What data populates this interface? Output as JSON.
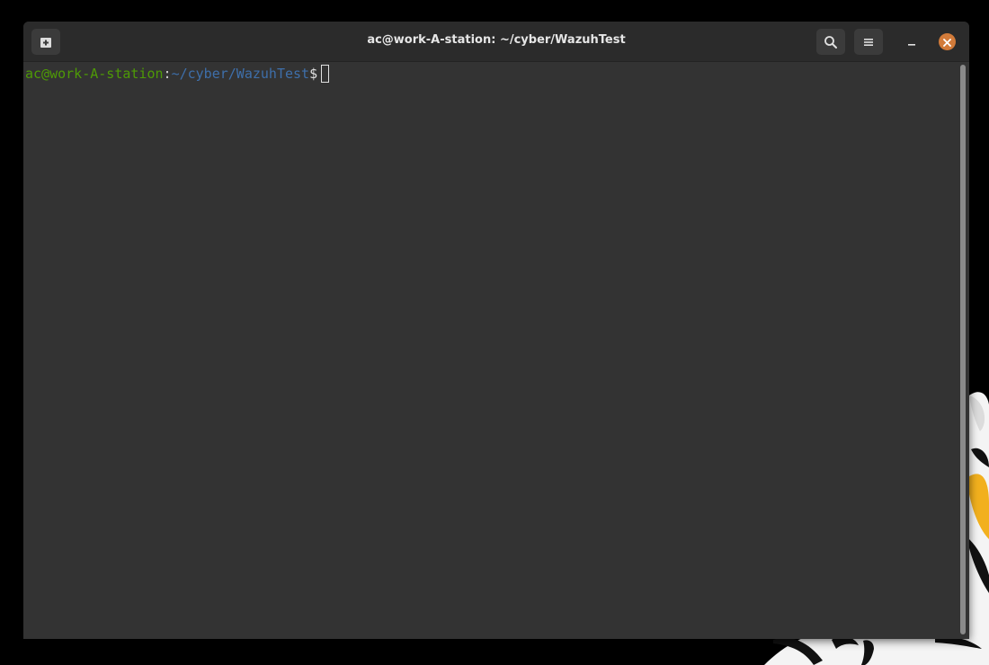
{
  "window": {
    "title": "ac@work-A-station: ~/cyber/WazuhTest"
  },
  "titlebar": {
    "new_tab_icon": "new-tab-icon",
    "search_icon": "search-icon",
    "menu_icon": "hamburger-menu-icon",
    "minimize_icon": "minimize-icon",
    "close_icon": "close-icon"
  },
  "terminal": {
    "prompt_user_host": "ac@work-A-station",
    "prompt_separator": ":",
    "prompt_path": "~/cyber/WazuhTest",
    "prompt_symbol": "$"
  },
  "colors": {
    "user_host": "#4e9a06",
    "path": "#3e6faa",
    "background": "#333333",
    "close_button": "#d27b3a"
  }
}
